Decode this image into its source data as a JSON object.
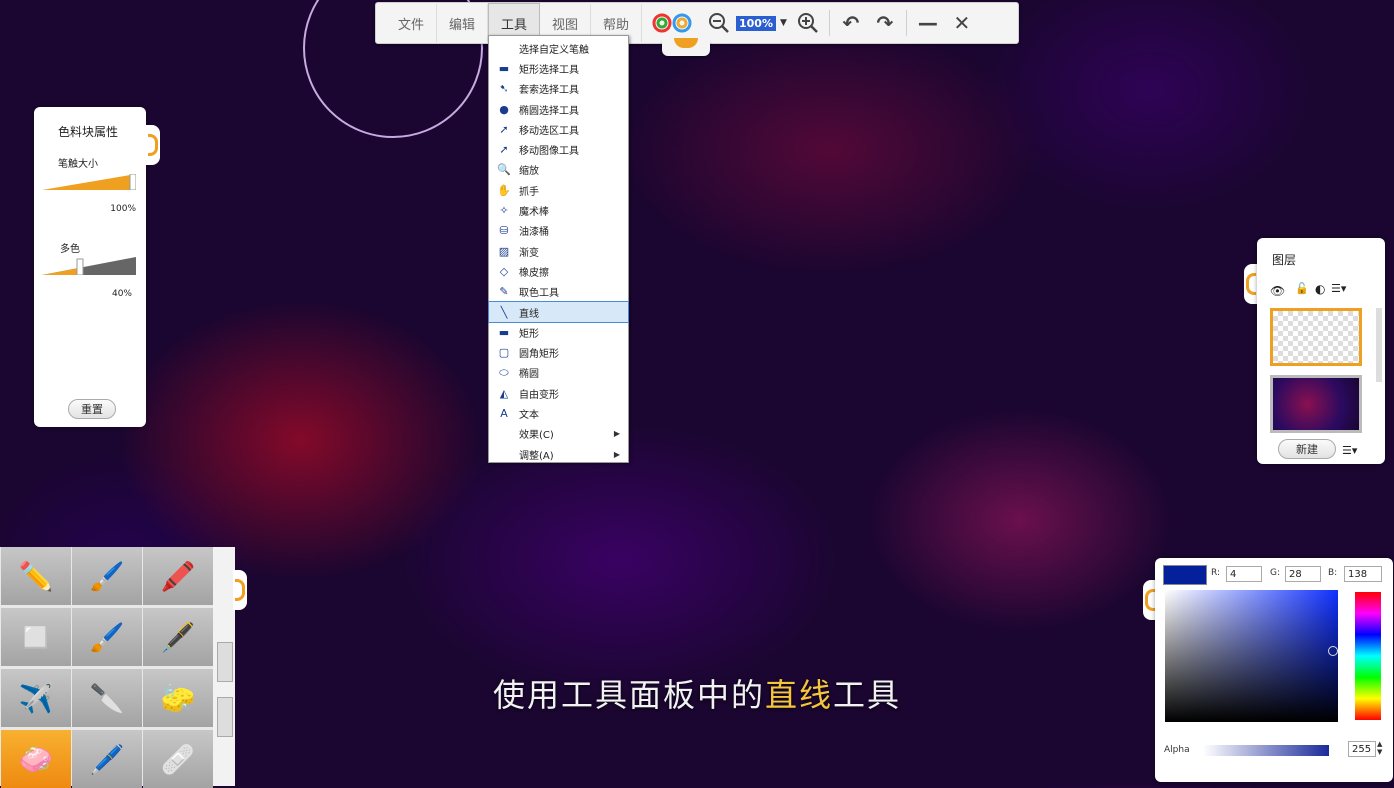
{
  "menubar": {
    "items": [
      "文件",
      "编辑",
      "工具",
      "视图",
      "帮助"
    ],
    "active_index": 2
  },
  "zoom": {
    "value": "100%"
  },
  "tools_menu": {
    "items": [
      {
        "label": "选择自定义笔触",
        "icon": "none-icon"
      },
      {
        "label": "矩形选择工具",
        "icon": "rect-select-icon"
      },
      {
        "label": "套索选择工具",
        "icon": "lasso-icon"
      },
      {
        "label": "椭圆选择工具",
        "icon": "ellipse-select-icon"
      },
      {
        "label": "移动选区工具",
        "icon": "move-selection-icon"
      },
      {
        "label": "移动图像工具",
        "icon": "move-image-icon"
      },
      {
        "label": "缩放",
        "icon": "zoom-icon"
      },
      {
        "label": "抓手",
        "icon": "hand-icon"
      },
      {
        "label": "魔术棒",
        "icon": "magic-wand-icon"
      },
      {
        "label": "油漆桶",
        "icon": "paint-bucket-icon"
      },
      {
        "label": "渐变",
        "icon": "gradient-icon"
      },
      {
        "label": "橡皮擦",
        "icon": "eraser-icon"
      },
      {
        "label": "取色工具",
        "icon": "eyedropper-icon"
      },
      {
        "label": "直线",
        "icon": "line-icon"
      },
      {
        "label": "矩形",
        "icon": "rectangle-icon"
      },
      {
        "label": "圆角矩形",
        "icon": "rounded-rect-icon"
      },
      {
        "label": "椭圆",
        "icon": "ellipse-icon"
      },
      {
        "label": "自由变形",
        "icon": "free-transform-icon"
      },
      {
        "label": "文本",
        "icon": "text-icon"
      },
      {
        "label": "效果(C)",
        "icon": "none-icon",
        "submenu": true
      },
      {
        "label": "调整(A)",
        "icon": "none-icon",
        "submenu": true
      }
    ],
    "selected_index": 13
  },
  "brush_props": {
    "title": "色料块属性",
    "size_label": "笔触大小",
    "size_value": "100%",
    "color_label": "多色",
    "color_value": "40%",
    "reset_label": "重置"
  },
  "layers": {
    "title": "图层",
    "new_label": "新建"
  },
  "color": {
    "swatch": "#04209a",
    "r_label": "R:",
    "g_label": "G:",
    "b_label": "B:",
    "r": "4",
    "g": "28",
    "b": "138",
    "alpha_label": "Alpha",
    "alpha": "255"
  },
  "subtitle": {
    "before": "使用工具面板中的",
    "highlight": "直线",
    "after": "工具"
  }
}
